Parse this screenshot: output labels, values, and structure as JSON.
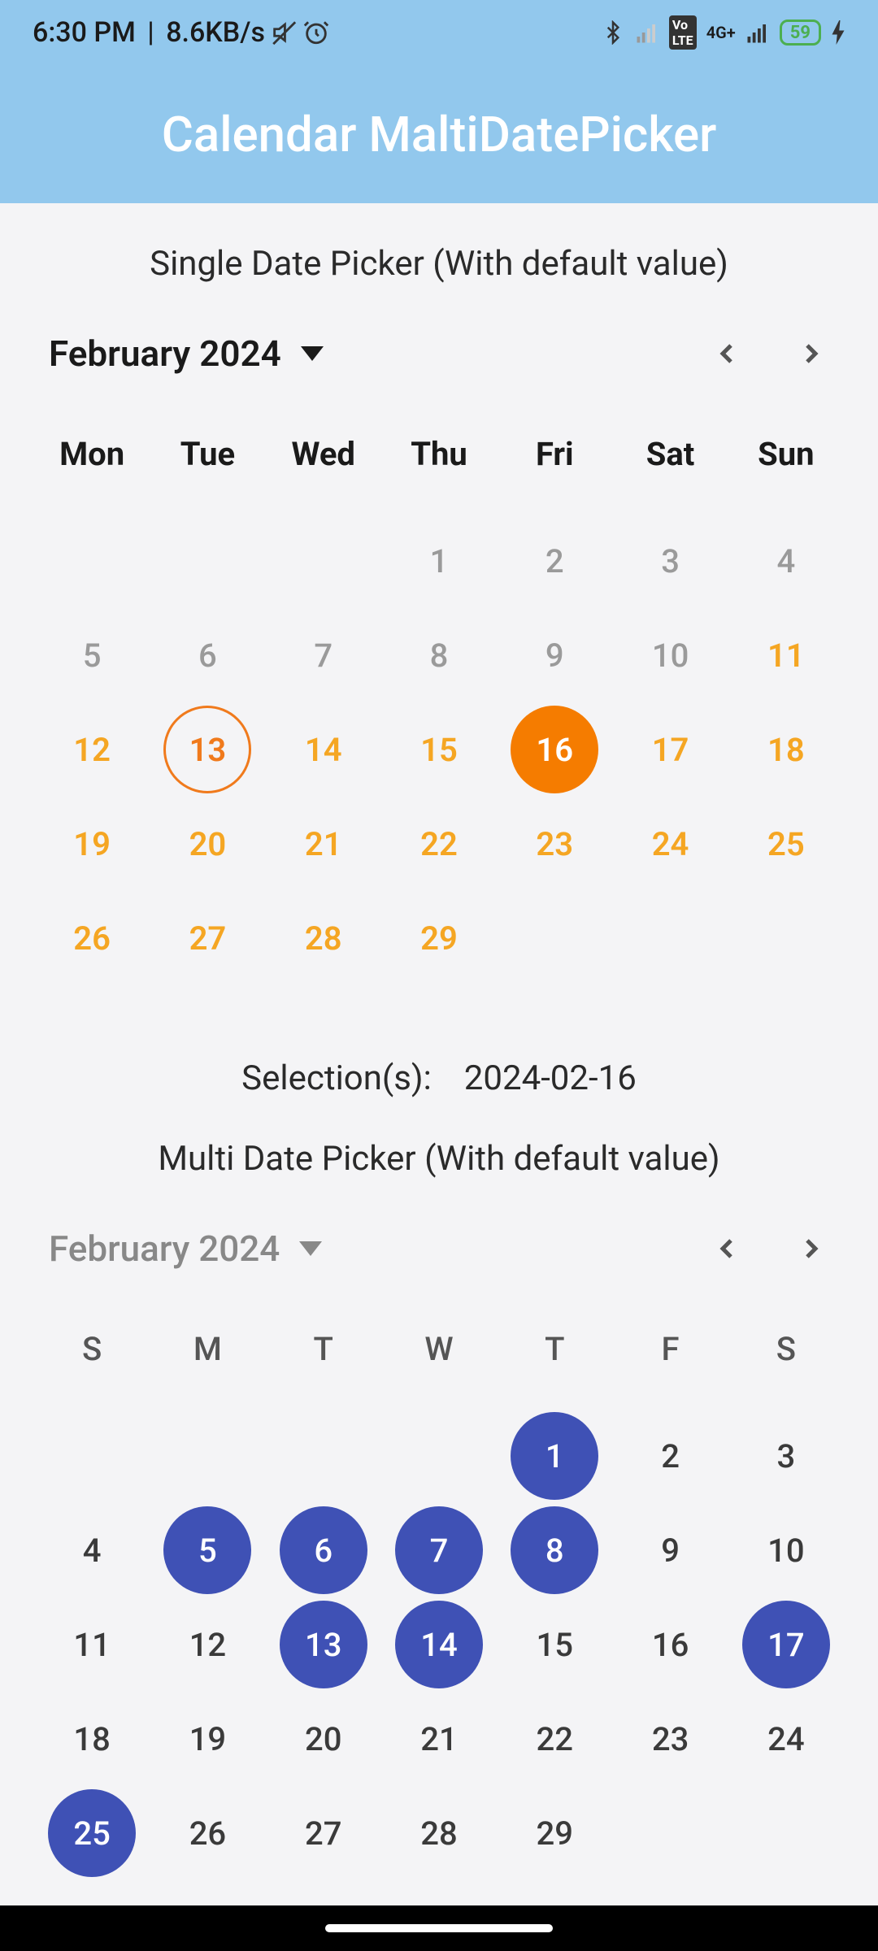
{
  "status": {
    "time": "6:30 PM",
    "speed": "8.6KB/s",
    "network_label": "4G+",
    "battery": "59"
  },
  "app": {
    "title": "Calendar MaltiDatePicker"
  },
  "single": {
    "title": "Single Date Picker (With default value)",
    "month": "February 2024",
    "dow": [
      "Mon",
      "Tue",
      "Wed",
      "Thu",
      "Fri",
      "Sat",
      "Sun"
    ],
    "weeks": [
      [
        {
          "n": ""
        },
        {
          "n": ""
        },
        {
          "n": ""
        },
        {
          "n": "1",
          "s": "past"
        },
        {
          "n": "2",
          "s": "past"
        },
        {
          "n": "3",
          "s": "past"
        },
        {
          "n": "4",
          "s": "past"
        }
      ],
      [
        {
          "n": "5",
          "s": "past"
        },
        {
          "n": "6",
          "s": "past"
        },
        {
          "n": "7",
          "s": "past"
        },
        {
          "n": "8",
          "s": "past"
        },
        {
          "n": "9",
          "s": "past"
        },
        {
          "n": "10",
          "s": "past"
        },
        {
          "n": "11",
          "s": "avail"
        }
      ],
      [
        {
          "n": "12",
          "s": "avail"
        },
        {
          "n": "13",
          "s": "today"
        },
        {
          "n": "14",
          "s": "avail"
        },
        {
          "n": "15",
          "s": "avail"
        },
        {
          "n": "16",
          "s": "sel-orange"
        },
        {
          "n": "17",
          "s": "avail"
        },
        {
          "n": "18",
          "s": "avail"
        }
      ],
      [
        {
          "n": "19",
          "s": "avail"
        },
        {
          "n": "20",
          "s": "avail"
        },
        {
          "n": "21",
          "s": "avail"
        },
        {
          "n": "22",
          "s": "avail"
        },
        {
          "n": "23",
          "s": "avail"
        },
        {
          "n": "24",
          "s": "avail"
        },
        {
          "n": "25",
          "s": "avail"
        }
      ],
      [
        {
          "n": "26",
          "s": "avail"
        },
        {
          "n": "27",
          "s": "avail"
        },
        {
          "n": "28",
          "s": "avail"
        },
        {
          "n": "29",
          "s": "avail"
        },
        {
          "n": ""
        },
        {
          "n": ""
        },
        {
          "n": ""
        }
      ]
    ],
    "selection_label": "Selection(s):",
    "selection_value": "2024-02-16"
  },
  "multi": {
    "title": "Multi Date Picker (With default value)",
    "month": "February 2024",
    "dow": [
      "S",
      "M",
      "T",
      "W",
      "T",
      "F",
      "S"
    ],
    "weeks": [
      [
        {
          "n": ""
        },
        {
          "n": ""
        },
        {
          "n": ""
        },
        {
          "n": ""
        },
        {
          "n": "1",
          "s": "sel-blue"
        },
        {
          "n": "2",
          "s": "plain"
        },
        {
          "n": "3",
          "s": "plain"
        }
      ],
      [
        {
          "n": "4",
          "s": "plain"
        },
        {
          "n": "5",
          "s": "sel-blue"
        },
        {
          "n": "6",
          "s": "sel-blue"
        },
        {
          "n": "7",
          "s": "sel-blue"
        },
        {
          "n": "8",
          "s": "sel-blue"
        },
        {
          "n": "9",
          "s": "plain"
        },
        {
          "n": "10",
          "s": "plain"
        }
      ],
      [
        {
          "n": "11",
          "s": "plain"
        },
        {
          "n": "12",
          "s": "plain"
        },
        {
          "n": "13",
          "s": "sel-blue"
        },
        {
          "n": "14",
          "s": "sel-blue"
        },
        {
          "n": "15",
          "s": "plain"
        },
        {
          "n": "16",
          "s": "plain"
        },
        {
          "n": "17",
          "s": "sel-blue"
        }
      ],
      [
        {
          "n": "18",
          "s": "plain"
        },
        {
          "n": "19",
          "s": "plain"
        },
        {
          "n": "20",
          "s": "plain"
        },
        {
          "n": "21",
          "s": "plain"
        },
        {
          "n": "22",
          "s": "plain"
        },
        {
          "n": "23",
          "s": "plain"
        },
        {
          "n": "24",
          "s": "plain"
        }
      ],
      [
        {
          "n": "25",
          "s": "sel-blue"
        },
        {
          "n": "26",
          "s": "plain"
        },
        {
          "n": "27",
          "s": "plain"
        },
        {
          "n": "28",
          "s": "plain"
        },
        {
          "n": "29",
          "s": "plain"
        },
        {
          "n": ""
        },
        {
          "n": ""
        }
      ]
    ]
  }
}
